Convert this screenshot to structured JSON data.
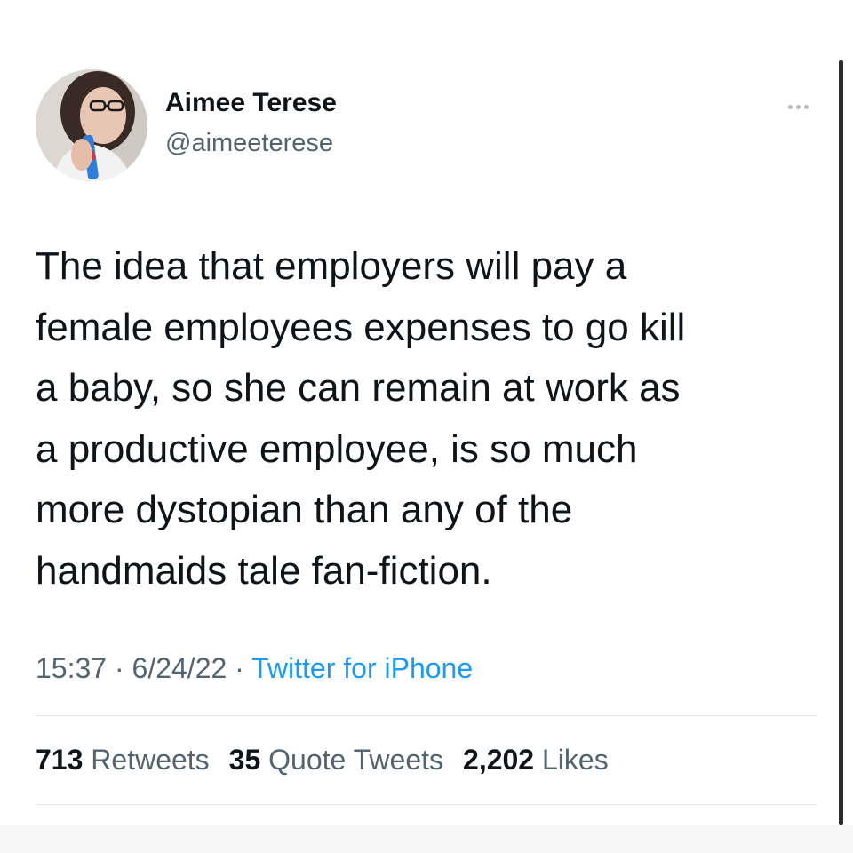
{
  "author": {
    "display_name": "Aimee Terese",
    "handle": "@aimeeterese"
  },
  "tweet": {
    "text": "The idea that employers will pay a\nfemale employees expenses to go kill\na baby, so she can remain at work as\na productive employee, is so much\nmore dystopian than any of the\nhandmaids tale fan-fiction.",
    "time": "15:37",
    "date": "6/24/22",
    "source": "Twitter for iPhone"
  },
  "stats": {
    "retweets_count": "713",
    "retweets_label": "Retweets",
    "quote_tweets_count": "35",
    "quote_tweets_label": "Quote Tweets",
    "likes_count": "2,202",
    "likes_label": "Likes"
  },
  "icons": {
    "more": "more-options-icon"
  },
  "colors": {
    "text_primary": "#0f1419",
    "text_secondary": "#536471",
    "link": "#1d9bf0",
    "divider": "#e4e7ea"
  }
}
